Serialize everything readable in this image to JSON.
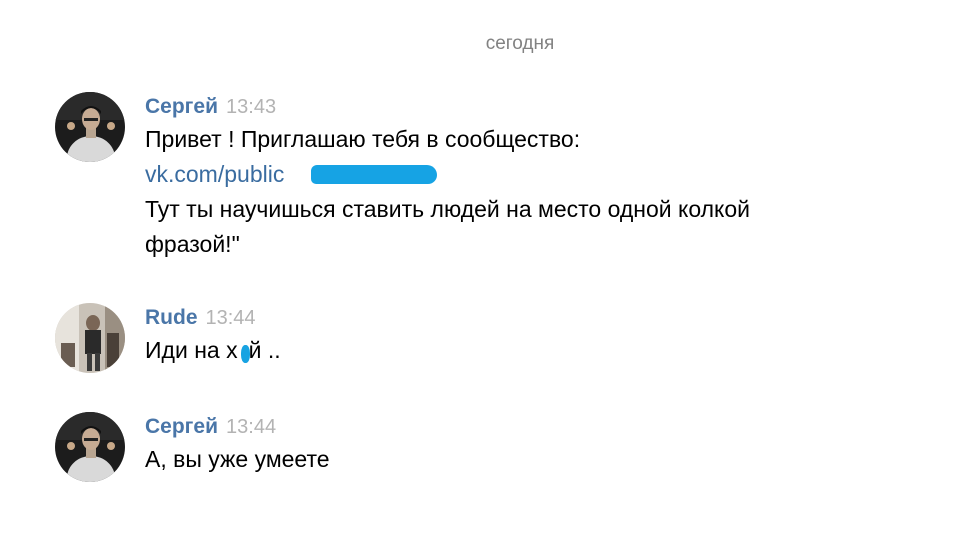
{
  "chat": {
    "date_separator": "сегодня",
    "messages": [
      {
        "author": "Сергей",
        "time": "13:43",
        "line1": "Привет ! Приглашаю тебя в сообщество:",
        "link_text": "vk.com/public",
        "line3": "Тут ты научишься ставить людей на место одной колкой",
        "line4": "фразой!\""
      },
      {
        "author": "Rude",
        "time": "13:44",
        "text_a": "Иди на х",
        "text_b": "й .."
      },
      {
        "author": "Сергей",
        "time": "13:44",
        "text": "А, вы уже умеете"
      }
    ]
  },
  "colors": {
    "author_name": "#4a76a8",
    "link": "#3a6ca0",
    "timestamp": "#b3b3b3",
    "redaction_mark": "#16a3e4"
  },
  "icons": {
    "avatar_sergey": "person-photo-avatar",
    "avatar_rude": "person-photo-avatar"
  }
}
